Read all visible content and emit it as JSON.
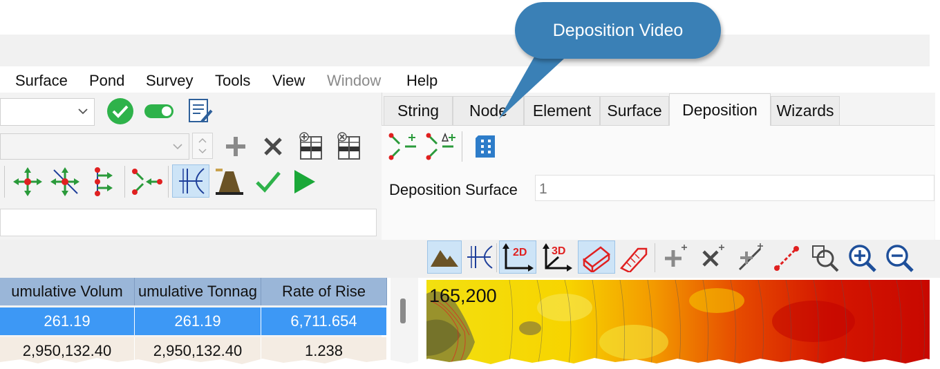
{
  "menu": {
    "items": [
      {
        "label": "Surface",
        "enabled": true
      },
      {
        "label": "Pond",
        "enabled": true
      },
      {
        "label": "Survey",
        "enabled": true
      },
      {
        "label": "Tools",
        "enabled": true
      },
      {
        "label": "View",
        "enabled": true
      },
      {
        "label": "Window",
        "enabled": false
      },
      {
        "label": "Help",
        "enabled": true
      }
    ]
  },
  "tabs": [
    {
      "label": "String",
      "active": false
    },
    {
      "label": "Node",
      "active": false
    },
    {
      "label": "Element",
      "active": false
    },
    {
      "label": "Surface",
      "active": false
    },
    {
      "label": "Deposition",
      "active": true
    },
    {
      "label": "Wizards",
      "active": false
    }
  ],
  "deposition": {
    "surface_label": "Deposition Surface",
    "surface_value": "1"
  },
  "callout": {
    "text": "Deposition Video"
  },
  "table": {
    "headers": [
      "umulative Volum",
      "umulative Tonnag",
      "Rate of Rise"
    ],
    "rows": [
      [
        "261.19",
        "261.19",
        "6,711.654"
      ],
      [
        "2,950,132.40",
        "2,950,132.40",
        "1.238"
      ]
    ]
  },
  "map": {
    "coordinate_text": "165,200"
  },
  "colors": {
    "header_bg": "#9ab6d8",
    "selected_row": "#3d98f5",
    "callout": "#3a80b6",
    "ok_green": "#2eb24a"
  }
}
